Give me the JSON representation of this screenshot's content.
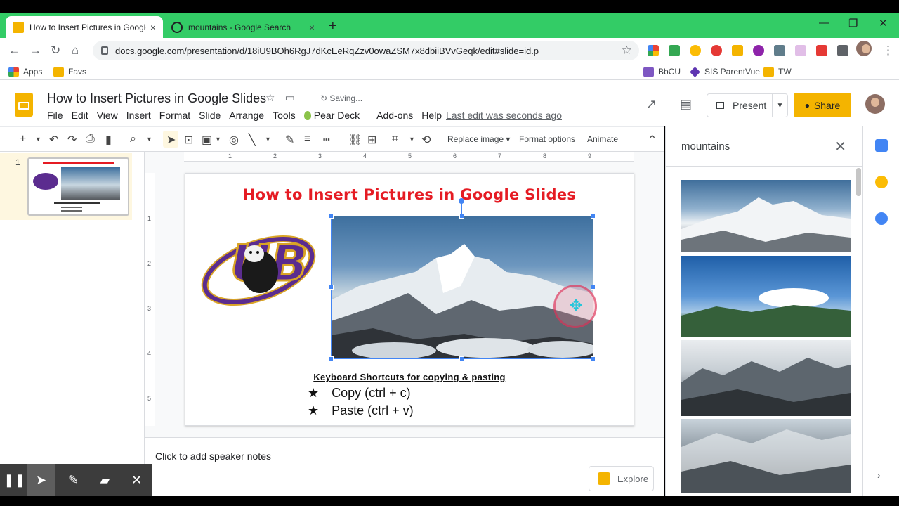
{
  "browser": {
    "tabs": [
      {
        "title": "How to Insert Pictures in Google",
        "close": "×"
      },
      {
        "title": "mountains - Google Search",
        "close": "×"
      }
    ],
    "new_tab": "+",
    "window_controls": [
      "—",
      "❐",
      "✕"
    ],
    "url": "docs.google.com/presentation/d/18iU9BOh6RgJ7dKcEeRqZzv0owaZSM7x8dbiiBVvGeqk/edit#slide=id.p",
    "bookmarks": [
      "Apps",
      "Favs",
      "BbCU",
      "SIS ParentVue",
      "TW"
    ]
  },
  "app": {
    "doc_title": "How to Insert Pictures in Google Slides",
    "saving": "Saving...",
    "menu": [
      "File",
      "Edit",
      "View",
      "Insert",
      "Format",
      "Slide",
      "Arrange",
      "Tools",
      "Pear Deck",
      "Add-ons",
      "Help"
    ],
    "last_edit": "Last edit was seconds ago",
    "present_label": "Present",
    "share_label": "Share"
  },
  "toolbar": {
    "replace_image": "Replace image",
    "format_options": "Format options",
    "animate": "Animate"
  },
  "filmstrip": {
    "slide_number": "1"
  },
  "slide": {
    "title": "How to Insert Pictures in Google Slides",
    "kb_title": "Keyboard Shortcuts for copying & pasting",
    "bullets": [
      "Copy (ctrl + c)",
      "Paste (ctrl + v)"
    ],
    "logo_letters": "UB"
  },
  "notes": {
    "placeholder": "Click to add speaker notes"
  },
  "explore": {
    "label": "Explore"
  },
  "side_panel": {
    "query": "mountains"
  },
  "colors": {
    "tab_strip": "#33cc66",
    "slides_yellow": "#f4b400",
    "title_red": "#e51b23",
    "selection_blue": "#4285f4"
  }
}
